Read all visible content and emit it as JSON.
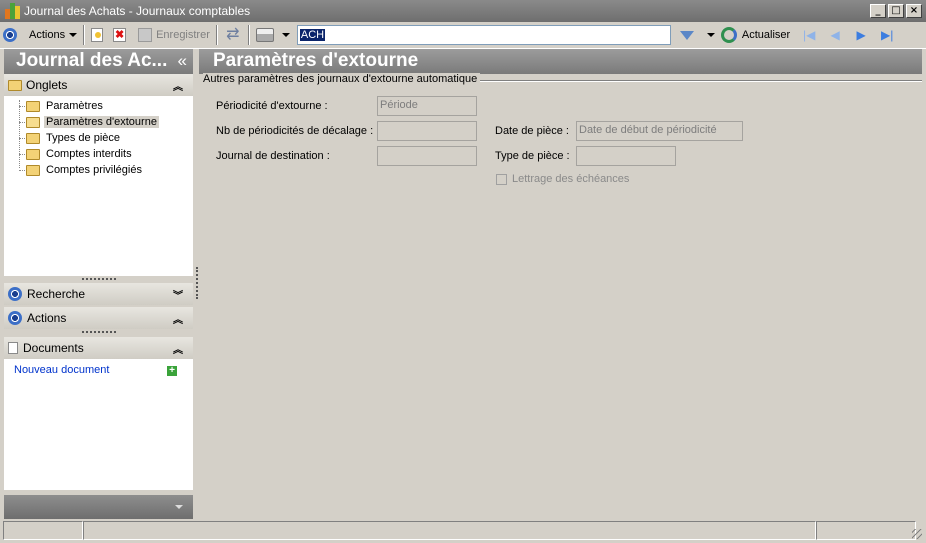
{
  "window": {
    "title": "Journal des Achats - Journaux comptables",
    "controls": {
      "minimize": "_",
      "maximize": "□",
      "close": "×"
    }
  },
  "toolbar": {
    "actions_label": "Actions",
    "save_label": "Enregistrer",
    "search_value": "ACH",
    "refresh_label": "Actualiser"
  },
  "left_panel": {
    "title": "Journal des Ac...",
    "collapse_glyph": "«",
    "onglets": {
      "label": "Onglets",
      "items": [
        {
          "label": "Paramètres"
        },
        {
          "label": "Paramètres d'extourne",
          "selected": true
        },
        {
          "label": "Types de pièce"
        },
        {
          "label": "Comptes interdits"
        },
        {
          "label": "Comptes privilégiés"
        }
      ]
    },
    "recherche_label": "Recherche",
    "actions_label": "Actions",
    "documents": {
      "label": "Documents",
      "new_document": "Nouveau document"
    }
  },
  "main": {
    "title": "Paramètres d'extourne",
    "group_title": "Autres paramètres des journaux d'extourne automatique",
    "fields": {
      "periodicite_label": "Périodicité d'extourne :",
      "periodicite_value": "Période",
      "nb_periodicites_label": "Nb de périodicités de décalage :",
      "nb_periodicites_value": "",
      "journal_destination_label": "Journal de destination :",
      "journal_destination_value": "",
      "date_piece_label": "Date de pièce :",
      "date_piece_value": "Date de début de périodicité",
      "type_piece_label": "Type de pièce :",
      "type_piece_value": "",
      "lettrage_label": "Lettrage des échéances",
      "lettrage_checked": false
    }
  }
}
